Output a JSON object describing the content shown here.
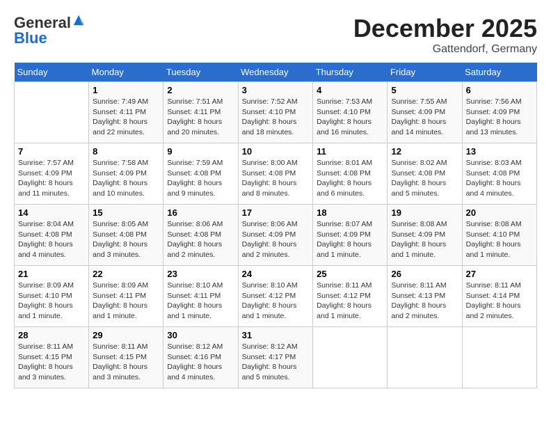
{
  "header": {
    "logo_line1": "General",
    "logo_line2": "Blue",
    "month_title": "December 2025",
    "location": "Gattendorf, Germany"
  },
  "weekdays": [
    "Sunday",
    "Monday",
    "Tuesday",
    "Wednesday",
    "Thursday",
    "Friday",
    "Saturday"
  ],
  "weeks": [
    [
      {
        "day": "",
        "info": ""
      },
      {
        "day": "1",
        "info": "Sunrise: 7:49 AM\nSunset: 4:11 PM\nDaylight: 8 hours\nand 22 minutes."
      },
      {
        "day": "2",
        "info": "Sunrise: 7:51 AM\nSunset: 4:11 PM\nDaylight: 8 hours\nand 20 minutes."
      },
      {
        "day": "3",
        "info": "Sunrise: 7:52 AM\nSunset: 4:10 PM\nDaylight: 8 hours\nand 18 minutes."
      },
      {
        "day": "4",
        "info": "Sunrise: 7:53 AM\nSunset: 4:10 PM\nDaylight: 8 hours\nand 16 minutes."
      },
      {
        "day": "5",
        "info": "Sunrise: 7:55 AM\nSunset: 4:09 PM\nDaylight: 8 hours\nand 14 minutes."
      },
      {
        "day": "6",
        "info": "Sunrise: 7:56 AM\nSunset: 4:09 PM\nDaylight: 8 hours\nand 13 minutes."
      }
    ],
    [
      {
        "day": "7",
        "info": "Sunrise: 7:57 AM\nSunset: 4:09 PM\nDaylight: 8 hours\nand 11 minutes."
      },
      {
        "day": "8",
        "info": "Sunrise: 7:58 AM\nSunset: 4:09 PM\nDaylight: 8 hours\nand 10 minutes."
      },
      {
        "day": "9",
        "info": "Sunrise: 7:59 AM\nSunset: 4:08 PM\nDaylight: 8 hours\nand 9 minutes."
      },
      {
        "day": "10",
        "info": "Sunrise: 8:00 AM\nSunset: 4:08 PM\nDaylight: 8 hours\nand 8 minutes."
      },
      {
        "day": "11",
        "info": "Sunrise: 8:01 AM\nSunset: 4:08 PM\nDaylight: 8 hours\nand 6 minutes."
      },
      {
        "day": "12",
        "info": "Sunrise: 8:02 AM\nSunset: 4:08 PM\nDaylight: 8 hours\nand 5 minutes."
      },
      {
        "day": "13",
        "info": "Sunrise: 8:03 AM\nSunset: 4:08 PM\nDaylight: 8 hours\nand 4 minutes."
      }
    ],
    [
      {
        "day": "14",
        "info": "Sunrise: 8:04 AM\nSunset: 4:08 PM\nDaylight: 8 hours\nand 4 minutes."
      },
      {
        "day": "15",
        "info": "Sunrise: 8:05 AM\nSunset: 4:08 PM\nDaylight: 8 hours\nand 3 minutes."
      },
      {
        "day": "16",
        "info": "Sunrise: 8:06 AM\nSunset: 4:08 PM\nDaylight: 8 hours\nand 2 minutes."
      },
      {
        "day": "17",
        "info": "Sunrise: 8:06 AM\nSunset: 4:09 PM\nDaylight: 8 hours\nand 2 minutes."
      },
      {
        "day": "18",
        "info": "Sunrise: 8:07 AM\nSunset: 4:09 PM\nDaylight: 8 hours\nand 1 minute."
      },
      {
        "day": "19",
        "info": "Sunrise: 8:08 AM\nSunset: 4:09 PM\nDaylight: 8 hours\nand 1 minute."
      },
      {
        "day": "20",
        "info": "Sunrise: 8:08 AM\nSunset: 4:10 PM\nDaylight: 8 hours\nand 1 minute."
      }
    ],
    [
      {
        "day": "21",
        "info": "Sunrise: 8:09 AM\nSunset: 4:10 PM\nDaylight: 8 hours\nand 1 minute."
      },
      {
        "day": "22",
        "info": "Sunrise: 8:09 AM\nSunset: 4:11 PM\nDaylight: 8 hours\nand 1 minute."
      },
      {
        "day": "23",
        "info": "Sunrise: 8:10 AM\nSunset: 4:11 PM\nDaylight: 8 hours\nand 1 minute."
      },
      {
        "day": "24",
        "info": "Sunrise: 8:10 AM\nSunset: 4:12 PM\nDaylight: 8 hours\nand 1 minute."
      },
      {
        "day": "25",
        "info": "Sunrise: 8:11 AM\nSunset: 4:12 PM\nDaylight: 8 hours\nand 1 minute."
      },
      {
        "day": "26",
        "info": "Sunrise: 8:11 AM\nSunset: 4:13 PM\nDaylight: 8 hours\nand 2 minutes."
      },
      {
        "day": "27",
        "info": "Sunrise: 8:11 AM\nSunset: 4:14 PM\nDaylight: 8 hours\nand 2 minutes."
      }
    ],
    [
      {
        "day": "28",
        "info": "Sunrise: 8:11 AM\nSunset: 4:15 PM\nDaylight: 8 hours\nand 3 minutes."
      },
      {
        "day": "29",
        "info": "Sunrise: 8:11 AM\nSunset: 4:15 PM\nDaylight: 8 hours\nand 3 minutes."
      },
      {
        "day": "30",
        "info": "Sunrise: 8:12 AM\nSunset: 4:16 PM\nDaylight: 8 hours\nand 4 minutes."
      },
      {
        "day": "31",
        "info": "Sunrise: 8:12 AM\nSunset: 4:17 PM\nDaylight: 8 hours\nand 5 minutes."
      },
      {
        "day": "",
        "info": ""
      },
      {
        "day": "",
        "info": ""
      },
      {
        "day": "",
        "info": ""
      }
    ]
  ]
}
